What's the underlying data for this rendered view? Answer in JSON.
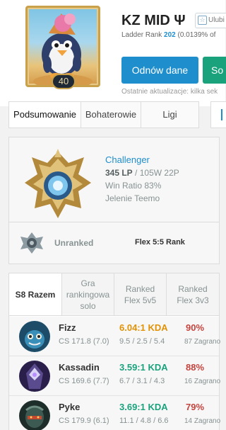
{
  "profile": {
    "summoner_name": "KZ MID Ψ",
    "level": "40",
    "favorite_label": "Ulubi",
    "ladder_prefix": "Ladder Rank",
    "ladder_rank": "202",
    "ladder_suffix": "(0.0139% of",
    "renew_label": "Odnów dane",
    "live_label": "So",
    "last_update": "Ostatnie aktualizacje: kilka sek"
  },
  "tabs": [
    {
      "label": "Podsumowanie",
      "active": true
    },
    {
      "label": "Bohaterowie",
      "active": false
    },
    {
      "label": "Ligi",
      "active": false
    }
  ],
  "ranked_solo": {
    "tier": "Challenger",
    "lp": "345 LP",
    "record": "/ 105W 22P",
    "win_ratio": "Win Ratio 83%",
    "league": "Jelenie Teemo"
  },
  "ranked_flex": {
    "tier": "Unranked",
    "label": "Flex 5:5 Rank"
  },
  "champion_tabs": [
    {
      "label": "S8 Razem",
      "active": true
    },
    {
      "label": "Gra rankingowa solo",
      "active": false
    },
    {
      "label": "Ranked Flex 5v5",
      "active": false
    },
    {
      "label": "Ranked Flex 3v3",
      "active": false
    }
  ],
  "champions": [
    {
      "name": "Fizz",
      "cs": "CS 171.8 (7.0)",
      "kda": "6.04:1 KDA",
      "kda_detail": "9.5 / 2.5 / 5.4",
      "win_rate": "90%",
      "games": "87 Zagrano",
      "kda_color": "#e19205"
    },
    {
      "name": "Kassadin",
      "cs": "CS 169.6 (7.7)",
      "kda": "3.59:1 KDA",
      "kda_detail": "6.7 / 3.1 / 4.3",
      "win_rate": "88%",
      "games": "16 Zagrano",
      "kda_color": "#1aa27d"
    },
    {
      "name": "Pyke",
      "cs": "CS 179.9 (6.1)",
      "kda": "3.69:1 KDA",
      "kda_detail": "11.1 / 4.8 / 6.6",
      "win_rate": "79%",
      "games": "14 Zagrano",
      "kda_color": "#1aa27d"
    }
  ],
  "colors": {
    "accent_blue": "#1f8ecd",
    "accent_green": "#1aa27d",
    "win_rate_red": "#c6443e"
  }
}
